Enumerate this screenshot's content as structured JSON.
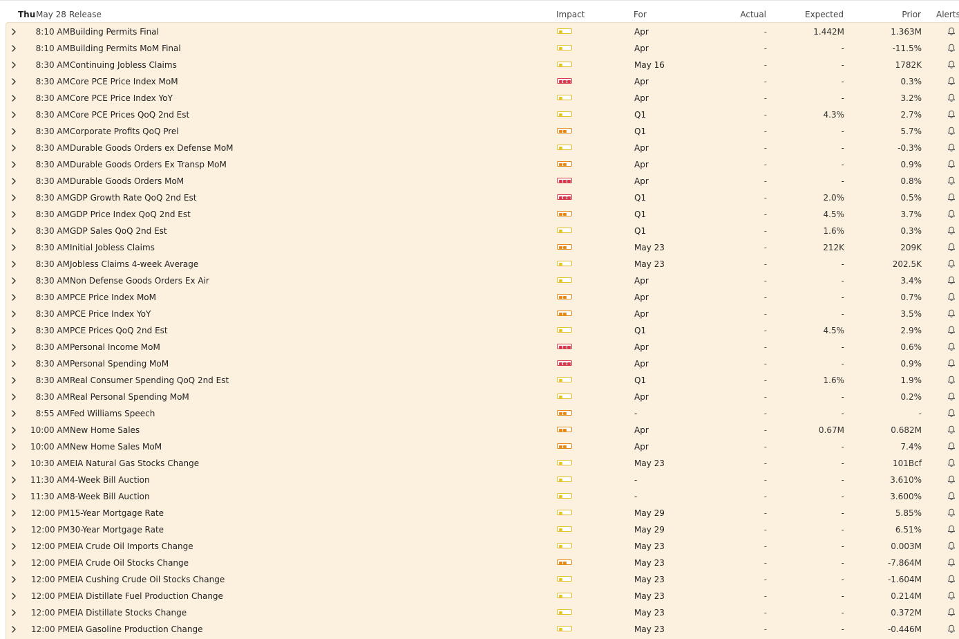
{
  "header": {
    "day": "Thu",
    "date": "May 28",
    "release": "Release",
    "impact": "Impact",
    "for": "For",
    "actual": "Actual",
    "expected": "Expected",
    "prior": "Prior",
    "alerts": "Alerts"
  },
  "impact_colors": {
    "low": "#e6c52c",
    "medium": "#e8891a",
    "high": "#d8384a"
  },
  "rows": [
    {
      "time": "8:10 AM",
      "name": "Building Permits Final",
      "impact": 1,
      "for": "Apr",
      "actual": "-",
      "expected": "1.442M",
      "prior": "1.363M"
    },
    {
      "time": "8:10 AM",
      "name": "Building Permits MoM Final",
      "impact": 1,
      "for": "Apr",
      "actual": "-",
      "expected": "-",
      "prior": "-11.5%"
    },
    {
      "time": "8:30 AM",
      "name": "Continuing Jobless Claims",
      "impact": 1,
      "for": "May 16",
      "actual": "-",
      "expected": "-",
      "prior": "1782K"
    },
    {
      "time": "8:30 AM",
      "name": "Core PCE Price Index MoM",
      "impact": 3,
      "for": "Apr",
      "actual": "-",
      "expected": "-",
      "prior": "0.3%"
    },
    {
      "time": "8:30 AM",
      "name": "Core PCE Price Index YoY",
      "impact": 1,
      "for": "Apr",
      "actual": "-",
      "expected": "-",
      "prior": "3.2%"
    },
    {
      "time": "8:30 AM",
      "name": "Core PCE Prices QoQ 2nd Est",
      "impact": 1,
      "for": "Q1",
      "actual": "-",
      "expected": "4.3%",
      "prior": "2.7%"
    },
    {
      "time": "8:30 AM",
      "name": "Corporate Profits QoQ Prel",
      "impact": 2,
      "for": "Q1",
      "actual": "-",
      "expected": "-",
      "prior": "5.7%"
    },
    {
      "time": "8:30 AM",
      "name": "Durable Goods Orders ex Defense MoM",
      "impact": 1,
      "for": "Apr",
      "actual": "-",
      "expected": "-",
      "prior": "-0.3%"
    },
    {
      "time": "8:30 AM",
      "name": "Durable Goods Orders Ex Transp MoM",
      "impact": 2,
      "for": "Apr",
      "actual": "-",
      "expected": "-",
      "prior": "0.9%"
    },
    {
      "time": "8:30 AM",
      "name": "Durable Goods Orders MoM",
      "impact": 3,
      "for": "Apr",
      "actual": "-",
      "expected": "-",
      "prior": "0.8%"
    },
    {
      "time": "8:30 AM",
      "name": "GDP Growth Rate QoQ 2nd Est",
      "impact": 3,
      "for": "Q1",
      "actual": "-",
      "expected": "2.0%",
      "prior": "0.5%"
    },
    {
      "time": "8:30 AM",
      "name": "GDP Price Index QoQ 2nd Est",
      "impact": 2,
      "for": "Q1",
      "actual": "-",
      "expected": "4.5%",
      "prior": "3.7%"
    },
    {
      "time": "8:30 AM",
      "name": "GDP Sales QoQ 2nd Est",
      "impact": 1,
      "for": "Q1",
      "actual": "-",
      "expected": "1.6%",
      "prior": "0.3%"
    },
    {
      "time": "8:30 AM",
      "name": "Initial Jobless Claims",
      "impact": 2,
      "for": "May 23",
      "actual": "-",
      "expected": "212K",
      "prior": "209K"
    },
    {
      "time": "8:30 AM",
      "name": "Jobless Claims 4-week Average",
      "impact": 1,
      "for": "May 23",
      "actual": "-",
      "expected": "-",
      "prior": "202.5K"
    },
    {
      "time": "8:30 AM",
      "name": "Non Defense Goods Orders Ex Air",
      "impact": 1,
      "for": "Apr",
      "actual": "-",
      "expected": "-",
      "prior": "3.4%"
    },
    {
      "time": "8:30 AM",
      "name": "PCE Price Index MoM",
      "impact": 2,
      "for": "Apr",
      "actual": "-",
      "expected": "-",
      "prior": "0.7%"
    },
    {
      "time": "8:30 AM",
      "name": "PCE Price Index YoY",
      "impact": 2,
      "for": "Apr",
      "actual": "-",
      "expected": "-",
      "prior": "3.5%"
    },
    {
      "time": "8:30 AM",
      "name": "PCE Prices QoQ 2nd Est",
      "impact": 1,
      "for": "Q1",
      "actual": "-",
      "expected": "4.5%",
      "prior": "2.9%"
    },
    {
      "time": "8:30 AM",
      "name": "Personal Income MoM",
      "impact": 3,
      "for": "Apr",
      "actual": "-",
      "expected": "-",
      "prior": "0.6%"
    },
    {
      "time": "8:30 AM",
      "name": "Personal Spending MoM",
      "impact": 3,
      "for": "Apr",
      "actual": "-",
      "expected": "-",
      "prior": "0.9%"
    },
    {
      "time": "8:30 AM",
      "name": "Real Consumer Spending QoQ 2nd Est",
      "impact": 1,
      "for": "Q1",
      "actual": "-",
      "expected": "1.6%",
      "prior": "1.9%"
    },
    {
      "time": "8:30 AM",
      "name": "Real Personal Spending MoM",
      "impact": 1,
      "for": "Apr",
      "actual": "-",
      "expected": "-",
      "prior": "0.2%"
    },
    {
      "time": "8:55 AM",
      "name": "Fed Williams Speech",
      "impact": 2,
      "for": "-",
      "actual": "-",
      "expected": "-",
      "prior": "-"
    },
    {
      "time": "10:00 AM",
      "name": "New Home Sales",
      "impact": 2,
      "for": "Apr",
      "actual": "-",
      "expected": "0.67M",
      "prior": "0.682M"
    },
    {
      "time": "10:00 AM",
      "name": "New Home Sales MoM",
      "impact": 2,
      "for": "Apr",
      "actual": "-",
      "expected": "-",
      "prior": "7.4%"
    },
    {
      "time": "10:30 AM",
      "name": "EIA Natural Gas Stocks Change",
      "impact": 1,
      "for": "May 23",
      "actual": "-",
      "expected": "-",
      "prior": "101Bcf"
    },
    {
      "time": "11:30 AM",
      "name": "4-Week Bill Auction",
      "impact": 1,
      "for": "-",
      "actual": "-",
      "expected": "-",
      "prior": "3.610%"
    },
    {
      "time": "11:30 AM",
      "name": "8-Week Bill Auction",
      "impact": 1,
      "for": "-",
      "actual": "-",
      "expected": "-",
      "prior": "3.600%"
    },
    {
      "time": "12:00 PM",
      "name": "15-Year Mortgage Rate",
      "impact": 1,
      "for": "May 29",
      "actual": "-",
      "expected": "-",
      "prior": "5.85%"
    },
    {
      "time": "12:00 PM",
      "name": "30-Year Mortgage Rate",
      "impact": 1,
      "for": "May 29",
      "actual": "-",
      "expected": "-",
      "prior": "6.51%"
    },
    {
      "time": "12:00 PM",
      "name": "EIA Crude Oil Imports Change",
      "impact": 1,
      "for": "May 23",
      "actual": "-",
      "expected": "-",
      "prior": "0.003M"
    },
    {
      "time": "12:00 PM",
      "name": "EIA Crude Oil Stocks Change",
      "impact": 2,
      "for": "May 23",
      "actual": "-",
      "expected": "-",
      "prior": "-7.864M"
    },
    {
      "time": "12:00 PM",
      "name": "EIA Cushing Crude Oil Stocks Change",
      "impact": 1,
      "for": "May 23",
      "actual": "-",
      "expected": "-",
      "prior": "-1.604M"
    },
    {
      "time": "12:00 PM",
      "name": "EIA Distillate Fuel Production Change",
      "impact": 1,
      "for": "May 23",
      "actual": "-",
      "expected": "-",
      "prior": "0.214M"
    },
    {
      "time": "12:00 PM",
      "name": "EIA Distillate Stocks Change",
      "impact": 1,
      "for": "May 23",
      "actual": "-",
      "expected": "-",
      "prior": "0.372M"
    },
    {
      "time": "12:00 PM",
      "name": "EIA Gasoline Production Change",
      "impact": 1,
      "for": "May 23",
      "actual": "-",
      "expected": "-",
      "prior": "-0.446M"
    }
  ]
}
